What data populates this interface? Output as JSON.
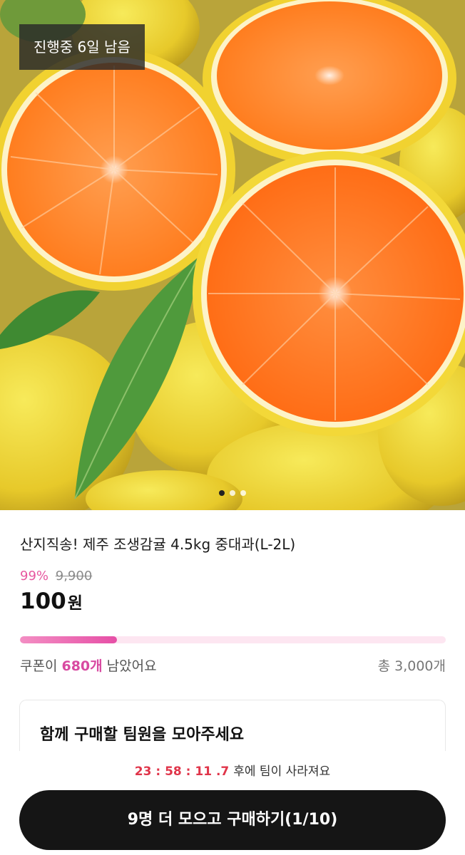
{
  "hero": {
    "status_tag": "진행중 6일 남음",
    "carousel": {
      "total": 3,
      "active_index": 0
    }
  },
  "product": {
    "title": "산지직송! 제주 조생감귤 4.5kg 중대과(L-2L)",
    "discount": "99%",
    "original_price": "9,900",
    "price": "100",
    "price_unit": "원"
  },
  "coupon": {
    "remaining_fraction": 0.227,
    "prefix": "쿠폰이 ",
    "count": "680개",
    "suffix": " 남았어요",
    "total": "총 3,000개"
  },
  "team": {
    "title": "함께 구매할 팀원을 모아주세요"
  },
  "bottom": {
    "timer": "23 : 58 : 11 .7",
    "timer_suffix": "후에 팀이 사라져요",
    "cta_label": "9명 더 모으고 구매하기(1/10)"
  },
  "colors": {
    "accent_pink": "#e7579f",
    "timer_red": "#e0354a",
    "cta_bg": "#151515"
  }
}
